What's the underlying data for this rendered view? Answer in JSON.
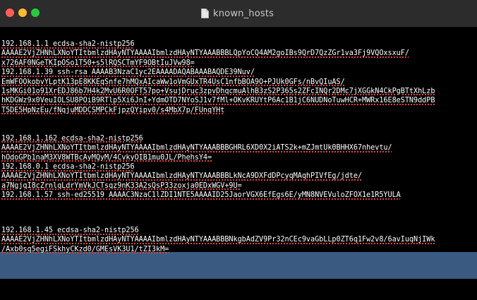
{
  "window": {
    "title": "known_hosts",
    "title_icon": "document-icon"
  },
  "colors": {
    "background": "#000000",
    "titlebar": "#2c2c2c",
    "text": "#ffffff",
    "selection": "#3a5a82",
    "spellcheck_underline": "#e0443e"
  },
  "lines": [
    "192.168.1.1 ecdsa-sha2-nistp256",
    "AAAAE2VjZHNhLXNoYTItbmlzdHAyNTYAAAAIbmlzdHAyNTYAAABBBLQpYoCQ4AM2goIBs9QrD7QzZGr1va3Fj9VQOxsxuF/",
    "x726AF0NGeTKIpOSo1T50+s5lRQSCTmYF9OBtIuJVw98=",
    "192.168.1.39 ssh-rsa AAAAB3NzaC1yc2EAAAADAQABAAABAQDE39Nuv/",
    "EmWFOOkobvYLptK13pE8KKEqSnfe7hMQxAIcaWw1oVmGUxTR4UsC1nfbBOA9O+PJUk0GFs/nBvQIuAS/",
    "1sMKGi01o91XrEDJ86b7H4k2MvU6R0OFT57po+VsujDruc3zpvDhqcmuAlhB3zS2P365s2ZFcINQr2DMc7jXGGkN4CkPgBTtXhLzb",
    "hKDGWz9x0VeuIOLSU8POiB9RTlp5Xi6JnI+YdmOTD7NYoSJ1v7fMl+OKvKRUYtP6Ac1B1jC6NUDNoTuwHCR+MWRx16E8eSTN9ddPB",
    "T5DE5HpNzEu/fNqjuMDDCSMPCkFjpzQYipv0/s4MbX7p/FUnqYHt",
    "",
    "",
    "192.168.1.162 ecdsa-sha2-nistp256",
    "AAAAE2VjZHNhLXNoYTItbmlzdHAyNTYAAAAIbmlzdHAyNTYAAABBBGHRL6XD0X2iATS2k+mZJmtUk0BHHX67nhevtu/",
    "hOdoGPb1naM3XV8WTBcAyMQyM/4CvkyOIB1mu0JL/PhehsY4=",
    "192.168.0.1 ecdsa-sha2-nistp256",
    "AAAAE2VjZHNhLXNoYTItbmlzdHAyNTYAAAAIbmlzdHAyNTYAAABBBLkNcA9DXFdDPcyqMAqhPIVfEg/jdte/",
    "a7NgjqI8cZrnlqLdrYmVkJCTsqz9nK33A2sQsP33zoxja0EDxWGV+9U=",
    "192.168.1.57 ssh-ed25519 AAAAC3NzaC1lZDI1NTE5AAAAID25JaorVGX6EfEgs6E/yMN8NVEVuloZFOX1e1R5YULA",
    "",
    "",
    ""
  ],
  "selected_lines": [
    "192.168.1.45 ecdsa-sha2-nistp256",
    "AAAAE2VjZHNhLXNoYTItbmlzdHAyNTYAAAAIbmlzdHAyNTYAAABBBNkgbAdZV9Pr32nCEc9vaGbLLp0ZT6q1Fw2v8/6avIuqNjIWk",
    "/Axb0sq5egiFSkhyCKzd0/GMEsVK3U1/tZI3kM="
  ]
}
